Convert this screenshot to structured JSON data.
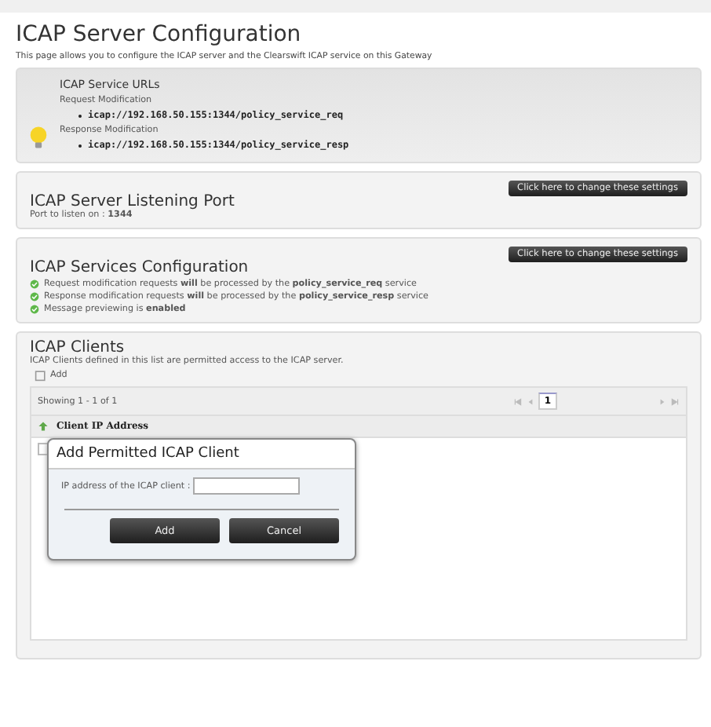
{
  "page": {
    "title": "ICAP Server Configuration",
    "description": "This page allows you to configure the ICAP server and the Clearswift ICAP service on this Gateway"
  },
  "service_urls": {
    "title": "ICAP Service URLs",
    "groups": [
      {
        "label": "Request Modification",
        "url": "icap://192.168.50.155:1344/policy_service_req"
      },
      {
        "label": "Response Modification",
        "url": "icap://192.168.50.155:1344/policy_service_resp"
      }
    ]
  },
  "listening_port": {
    "title": "ICAP Server Listening Port",
    "button": "Click here to change these settings",
    "label": "Port to listen on : ",
    "value": "1344"
  },
  "services": {
    "title": "ICAP Services Configuration",
    "button": "Click here to change these settings",
    "items": [
      {
        "text": "Request modification requests **will** be processed by the **policy_service_req** service",
        "ok": true
      },
      {
        "text": "Response modification requests **will** be processed by the **policy_service_resp** service",
        "ok": true
      },
      {
        "text": "Message previewing is **enabled**",
        "ok": true
      }
    ]
  },
  "clients": {
    "title": "ICAP Clients",
    "description": "ICAP Clients defined in this list are permitted access to the ICAP server.",
    "add": "Add",
    "showing": "Showing 1 - 1 of 1",
    "page": "1",
    "column": "Client IP Address",
    "rows": [
      {
        "checked": false
      }
    ]
  },
  "dialog": {
    "title": "Add Permitted ICAP Client",
    "field_label": "IP address of the ICAP client :",
    "buttons": [
      "Add",
      "Cancel"
    ]
  }
}
